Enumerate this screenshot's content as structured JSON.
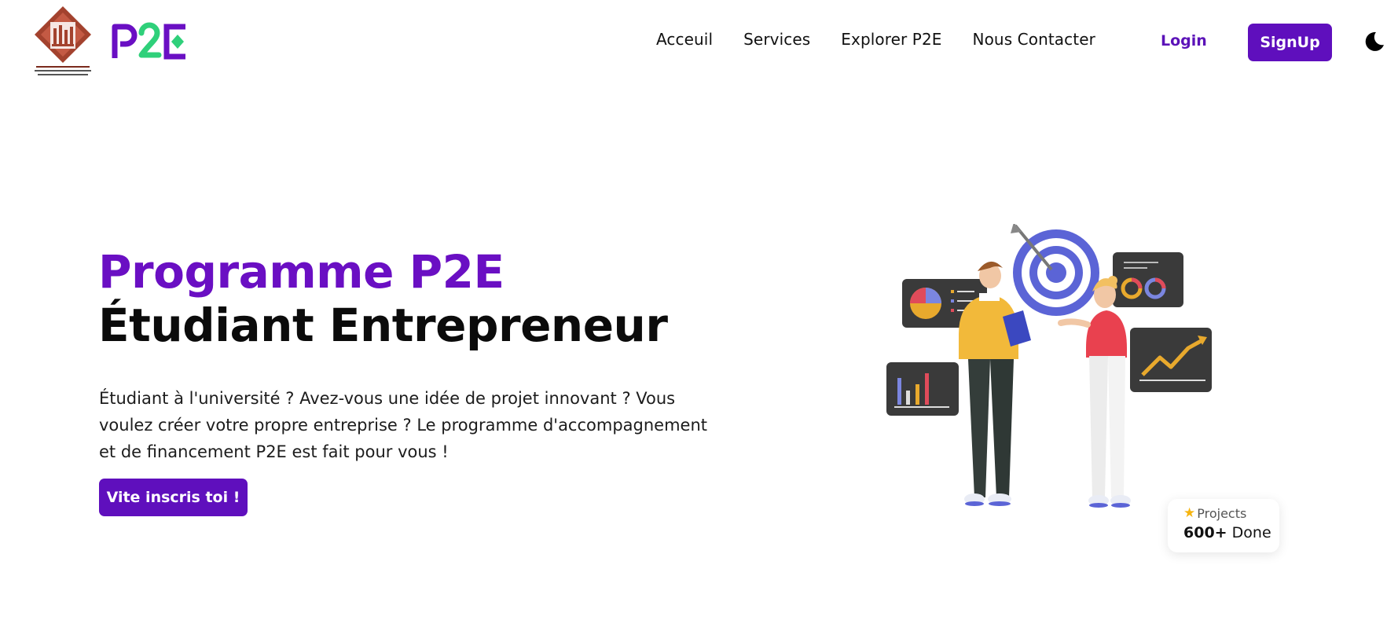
{
  "header": {
    "brand": "P2E",
    "nav": [
      "Acceuil",
      "Services",
      "Explorer P2E",
      "Nous Contacter"
    ],
    "login_label": "Login",
    "signup_label": "SignUp"
  },
  "hero": {
    "title_line1": "Programme P2E",
    "title_line2": "Étudiant Entrepreneur",
    "description": "Étudiant à l'université ? Avez-vous une idée de projet innovant ? Vous voulez créer votre propre entreprise ? Le programme d'accompagnement et de financement P2E est fait pour vous !",
    "cta_label": "Vite inscris toi !"
  },
  "badge": {
    "icon": "star-icon",
    "label": "Projects",
    "count": "600+",
    "suffix": "Done"
  },
  "colors": {
    "accent": "#5f0fbd",
    "accent_title": "#6a0fc3",
    "brand_green": "#2fd07a",
    "uni_red": "#a3422e"
  }
}
